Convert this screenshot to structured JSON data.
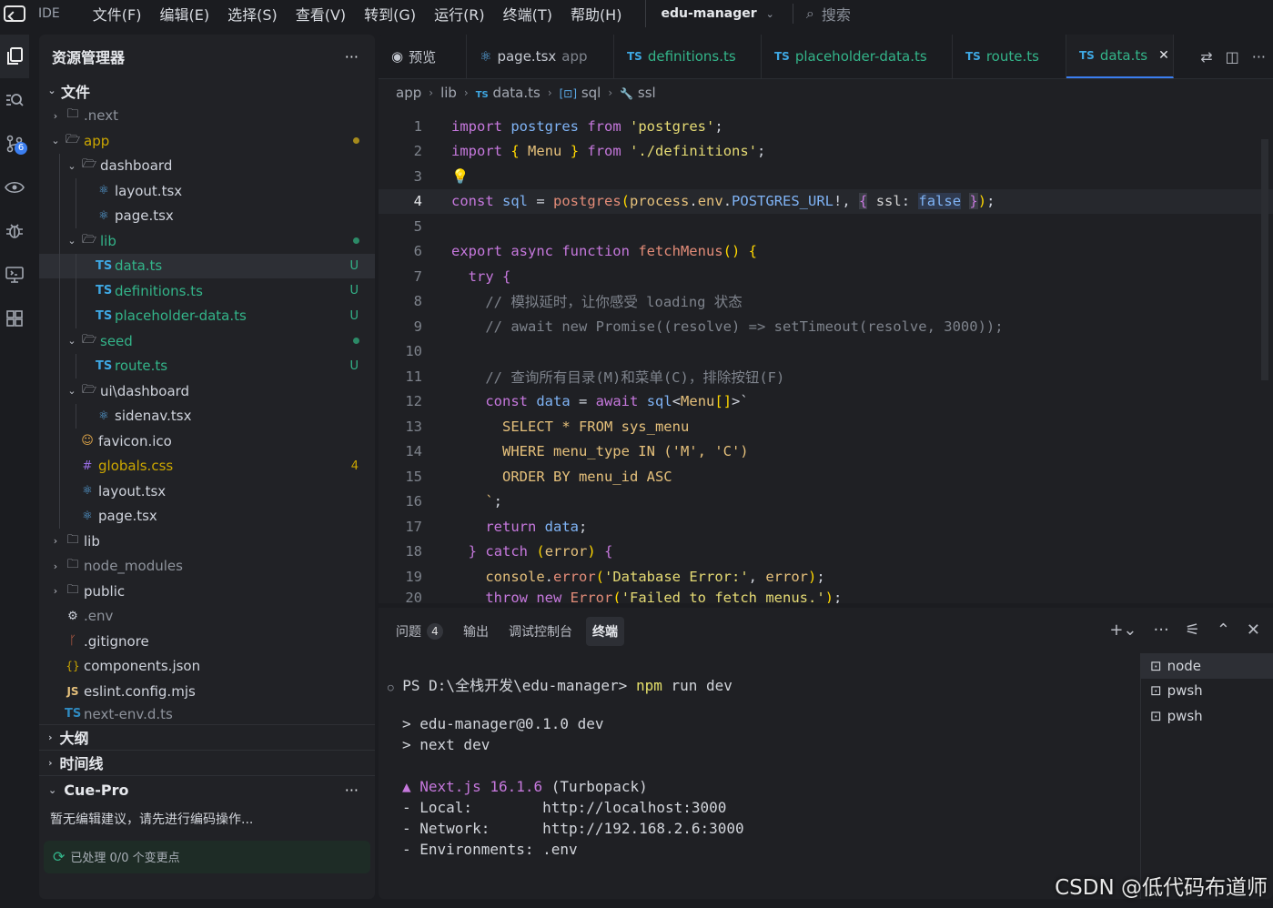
{
  "titlebar": {
    "ide_label": "IDE",
    "menus": [
      "文件(F)",
      "编辑(E)",
      "选择(S)",
      "查看(V)",
      "转到(G)",
      "运行(R)",
      "终端(T)",
      "帮助(H)"
    ],
    "project": "edu-manager",
    "search_label": "搜索"
  },
  "activity": {
    "scm_badge": "6"
  },
  "sidebar": {
    "title": "资源管理器",
    "root_label": "文件",
    "items": [
      {
        "label": ".next"
      },
      {
        "label": "app"
      },
      {
        "label": "dashboard"
      },
      {
        "label": "layout.tsx"
      },
      {
        "label": "page.tsx"
      },
      {
        "label": "lib"
      },
      {
        "label": "data.ts",
        "status": "U",
        "type_tag": "TS"
      },
      {
        "label": "definitions.ts",
        "status": "U",
        "type_tag": "TS"
      },
      {
        "label": "placeholder-data.ts",
        "status": "U",
        "type_tag": "TS"
      },
      {
        "label": "seed"
      },
      {
        "label": "route.ts",
        "status": "U",
        "type_tag": "TS"
      },
      {
        "label": "ui\\dashboard"
      },
      {
        "label": "sidenav.tsx"
      },
      {
        "label": "favicon.ico"
      },
      {
        "label": "globals.css",
        "status": "4"
      },
      {
        "label": "layout.tsx"
      },
      {
        "label": "page.tsx"
      },
      {
        "label": "lib"
      },
      {
        "label": "node_modules"
      },
      {
        "label": "public"
      },
      {
        "label": ".env"
      },
      {
        "label": ".gitignore"
      },
      {
        "label": "components.json"
      },
      {
        "label": "eslint.config.mjs",
        "type_tag": "JS"
      },
      {
        "label": "next-env.d.ts",
        "type_tag": "TS"
      }
    ],
    "sections": {
      "outline": "大纲",
      "timeline": "时间线",
      "cue": "Cue-Pro"
    },
    "cue_message": "暂无编辑建议，请先进行编码操作...",
    "cue_status": "已处理 0/0 个变更点"
  },
  "editor": {
    "tabs": [
      {
        "label": "预览"
      },
      {
        "label": "page.tsx",
        "sub": "app"
      },
      {
        "label": "definitions.ts",
        "type_tag": "TS"
      },
      {
        "label": "placeholder-data.ts",
        "type_tag": "TS"
      },
      {
        "label": "route.ts",
        "type_tag": "TS"
      },
      {
        "label": "data.ts",
        "type_tag": "TS"
      }
    ],
    "breadcrumb": [
      "app",
      "lib",
      "data.ts",
      "sql",
      "ssl"
    ],
    "line_numbers": [
      "1",
      "2",
      "3",
      "4",
      "5",
      "6",
      "7",
      "8",
      "9",
      "10",
      "11",
      "12",
      "13",
      "14",
      "15",
      "16",
      "17",
      "18",
      "19",
      "20"
    ]
  },
  "panel": {
    "tabs": [
      {
        "label": "问题",
        "badge": "4"
      },
      {
        "label": "输出"
      },
      {
        "label": "调试控制台"
      },
      {
        "label": "终端"
      }
    ],
    "terminal": {
      "prompt": "PS D:\\全栈开发\\edu-manager> ",
      "command": "npm",
      "command_rest": " run dev",
      "lines": [
        "> edu-manager@0.1.0 dev",
        "> next dev"
      ],
      "next_version_label": "▲ Next.js 16.1.6",
      "next_suffix": " (Turbopack)",
      "info": [
        "- Local:        http://localhost:3000",
        "- Network:      http://192.168.2.6:3000",
        "- Environments: .env"
      ]
    },
    "terminal_list": [
      "node",
      "pwsh",
      "pwsh"
    ]
  },
  "watermark": "CSDN @低代码布道师"
}
